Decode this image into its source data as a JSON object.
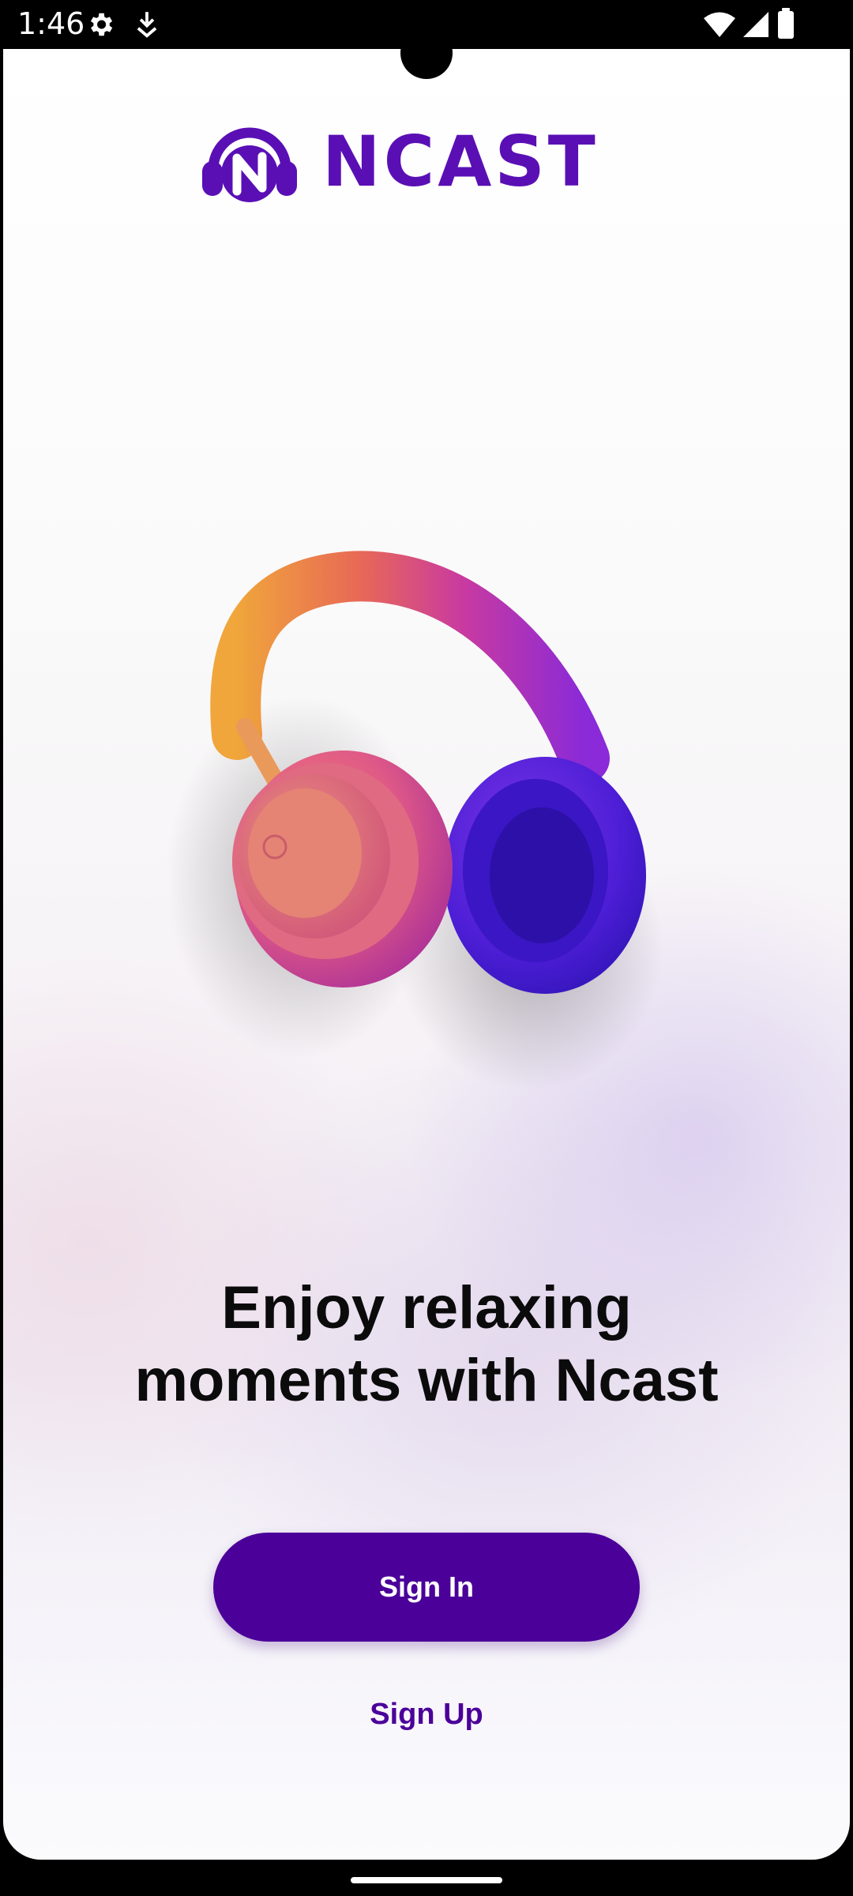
{
  "status_bar": {
    "time": "1:46",
    "left_icons": [
      "gear-icon",
      "download-status-icon"
    ],
    "right_icons": [
      "wifi-icon",
      "cellular-signal-icon",
      "battery-icon"
    ]
  },
  "app": {
    "brand": {
      "name": "NCAST",
      "color": "#5a0fb5"
    },
    "hero": {
      "image": "headphones-illustration"
    },
    "headline": {
      "line1": "Enjoy relaxing",
      "line2": "moments with Ncast"
    },
    "actions": {
      "sign_in_label": "Sign In",
      "sign_up_label": "Sign Up"
    },
    "colors": {
      "primary": "#4b0099",
      "text": "#0b0b0b"
    }
  }
}
